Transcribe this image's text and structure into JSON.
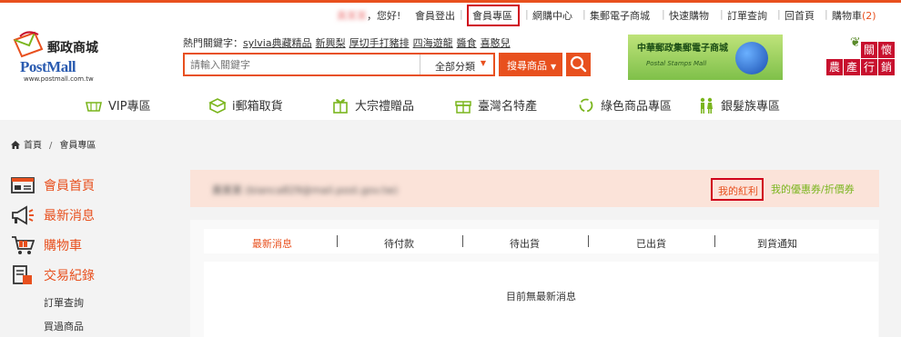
{
  "top_nav": {
    "user_name": "黃某某",
    "greeting": "，您好!",
    "items": [
      {
        "label": "會員登出"
      },
      {
        "label": "會員專區"
      },
      {
        "label": "網購中心"
      },
      {
        "label": "集郵電子商城"
      },
      {
        "label": "快速購物"
      },
      {
        "label": "訂單查詢"
      },
      {
        "label": "回首頁"
      },
      {
        "label": "購物車"
      }
    ],
    "cart_count": "(2)"
  },
  "logo": {
    "name_cn": "郵政商城",
    "name_en": "PostMall",
    "url": "www.postmall.com.tw"
  },
  "hot_keywords": {
    "label": "熱門關鍵字：",
    "items": [
      "sylvia典藏精品",
      "新興梨",
      "厚切手打豬排",
      "四海遊龍",
      "醬食",
      "喜憨兒"
    ]
  },
  "search": {
    "placeholder": "請輸入關鍵字",
    "category": "全部分類",
    "button": "搜尋商品"
  },
  "banner": {
    "title": "中華郵政集郵電子商城",
    "subtitle": "Postal Stamps Mall"
  },
  "care": {
    "chars": [
      "關",
      "懷",
      "農",
      "產",
      "行",
      "銷"
    ]
  },
  "categories": [
    {
      "label": "VIP專區"
    },
    {
      "label": "i郵箱取貨"
    },
    {
      "label": "大宗禮贈品"
    },
    {
      "label": "臺灣名特產"
    },
    {
      "label": "綠色商品專區"
    },
    {
      "label": "銀髮族專區"
    }
  ],
  "breadcrumb": {
    "home": "首頁",
    "separator": "/",
    "current": "會員專區"
  },
  "sidebar": {
    "items": [
      {
        "label": "會員首頁"
      },
      {
        "label": "最新消息"
      },
      {
        "label": "購物車"
      },
      {
        "label": "交易紀錄"
      }
    ],
    "sub_items": [
      "訂單查詢",
      "買過商品"
    ]
  },
  "member": {
    "name_email": "黃某某 (bianca829@mail.post.gov.tw)",
    "bonus_link": "我的紅利",
    "coupon_link": "我的優惠券/折價券"
  },
  "order_tabs": [
    {
      "label": "最新消息"
    },
    {
      "label": "待付款"
    },
    {
      "label": "待出貨"
    },
    {
      "label": "已出貨"
    },
    {
      "label": "到貨通知"
    }
  ],
  "empty_message": "目前無最新消息",
  "colors": {
    "brand_orange": "#e8501e",
    "highlight_red": "#d0021b",
    "green": "#7ab51d"
  }
}
